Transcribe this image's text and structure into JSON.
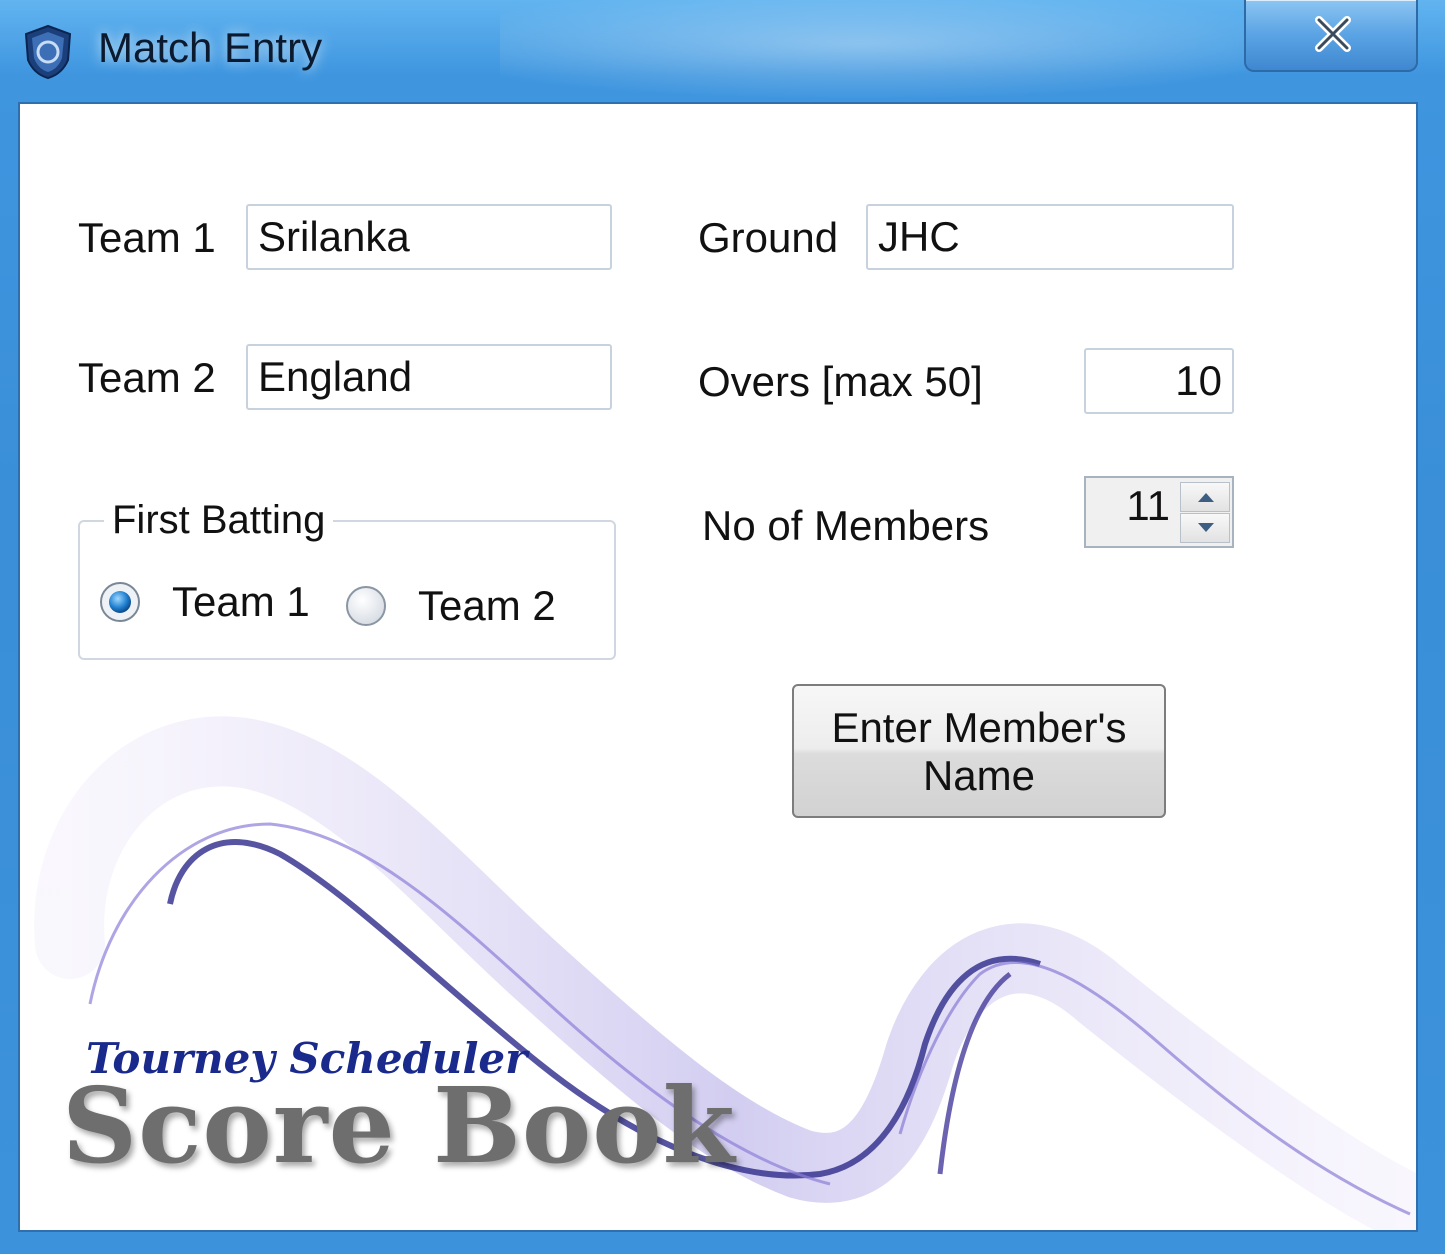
{
  "window": {
    "title": "Match Entry"
  },
  "form": {
    "team1_label": "Team 1",
    "team1_value": "Srilanka",
    "team2_label": "Team 2",
    "team2_value": "England",
    "ground_label": "Ground",
    "ground_value": "JHC",
    "overs_label": "Overs [max 50]",
    "overs_value": "10",
    "members_label": "No of Members",
    "members_value": "11"
  },
  "first_batting": {
    "legend": "First Batting",
    "options": [
      {
        "label": "Team 1",
        "selected": true
      },
      {
        "label": "Team 2",
        "selected": false
      }
    ]
  },
  "actions": {
    "enter_members_line1": "Enter Member's",
    "enter_members_line2": "Name"
  },
  "branding": {
    "subtitle": "Tourney Scheduler",
    "title": "Score Book"
  },
  "colors": {
    "title_bar": "#3a8fd8",
    "radio_selected": "#1f7fd0",
    "brand_text": "#6e6e6e",
    "brand_subtitle": "#1a2a8c"
  },
  "icons": {
    "app": "shield-logo-icon",
    "close": "close-icon",
    "spin_up": "caret-up-icon",
    "spin_down": "caret-down-icon"
  }
}
